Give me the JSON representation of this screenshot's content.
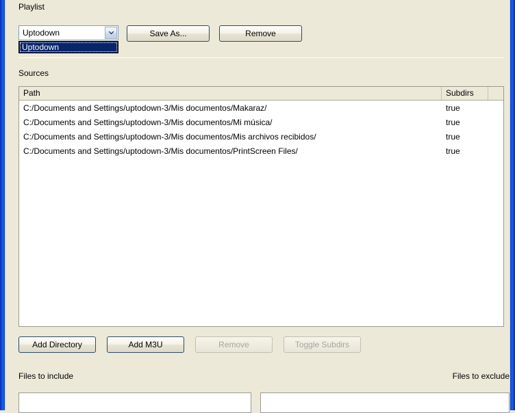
{
  "window": {
    "frame_color": "#0a46d8",
    "background_color": "#ece9d8"
  },
  "playlist": {
    "label": "Playlist",
    "combo": {
      "selected_value": "Uptodown",
      "expanded": true,
      "arrow_icon": "chevron-down-icon",
      "options": [
        "Uptodown"
      ]
    },
    "save_as_label": "Save As...",
    "remove_label": "Remove"
  },
  "sources": {
    "label": "Sources",
    "columns": [
      "Path",
      "Subdirs"
    ],
    "rows": [
      {
        "path": "C:/Documents and Settings/uptodown-3/Mis documentos/Makaraz/",
        "subdirs": "true"
      },
      {
        "path": "C:/Documents and Settings/uptodown-3/Mis documentos/Mi música/",
        "subdirs": "true"
      },
      {
        "path": "C:/Documents and Settings/uptodown-3/Mis documentos/Mis archivos recibidos/",
        "subdirs": "true"
      },
      {
        "path": "C:/Documents and Settings/uptodown-3/Mis documentos/PrintScreen Files/",
        "subdirs": "true"
      }
    ],
    "buttons": {
      "add_directory": {
        "label": "Add Directory",
        "enabled": true
      },
      "add_m3u": {
        "label": "Add M3U",
        "enabled": true
      },
      "remove": {
        "label": "Remove",
        "enabled": false
      },
      "toggle_subdirs": {
        "label": "Toggle Subdirs",
        "enabled": false
      }
    }
  },
  "filters": {
    "include_label": "Files to include",
    "include_value": "",
    "exclude_label": "Files to exclude",
    "exclude_value": ""
  }
}
